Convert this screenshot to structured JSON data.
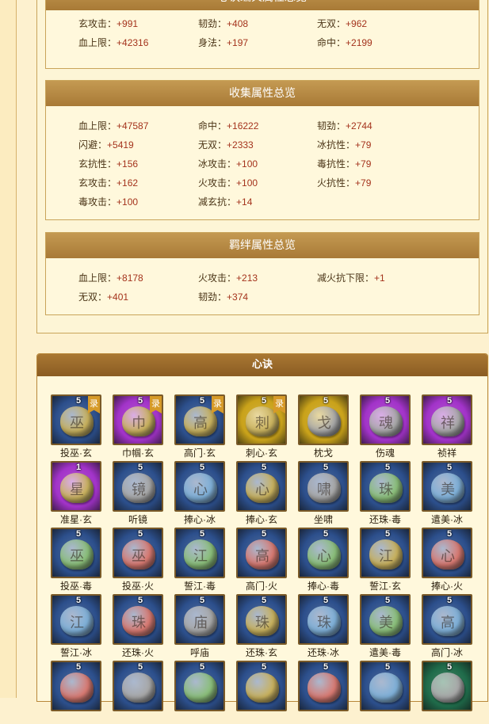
{
  "sections": [
    {
      "title": "心诀编火属性总览",
      "rows": [
        [
          {
            "label": "玄攻击：",
            "value": "+991"
          },
          {
            "label": "韧劲：",
            "value": "+408"
          },
          {
            "label": "无双：",
            "value": "+962"
          }
        ],
        [
          {
            "label": "血上限：",
            "value": "+42316"
          },
          {
            "label": "身法：",
            "value": "+197"
          },
          {
            "label": "命中：",
            "value": "+2199"
          }
        ]
      ]
    },
    {
      "title": "收集属性总览",
      "rows": [
        [
          {
            "label": "血上限：",
            "value": "+47587"
          },
          {
            "label": "命中：",
            "value": "+16222"
          },
          {
            "label": "韧劲：",
            "value": "+2744"
          }
        ],
        [
          {
            "label": "闪避：",
            "value": "+5419"
          },
          {
            "label": "无双：",
            "value": "+2333"
          },
          {
            "label": "冰抗性：",
            "value": "+79"
          }
        ],
        [
          {
            "label": "玄抗性：",
            "value": "+156"
          },
          {
            "label": "冰攻击：",
            "value": "+100"
          },
          {
            "label": "毒抗性：",
            "value": "+79"
          }
        ],
        [
          {
            "label": "玄攻击：",
            "value": "+162"
          },
          {
            "label": "火攻击：",
            "value": "+100"
          },
          {
            "label": "火抗性：",
            "value": "+79"
          }
        ],
        [
          {
            "label": "毒攻击：",
            "value": "+100"
          },
          {
            "label": "减玄抗：",
            "value": "+14"
          }
        ]
      ]
    },
    {
      "title": "羁绊属性总览",
      "rows": [
        [
          {
            "label": "血上限：",
            "value": "+8178"
          },
          {
            "label": "火攻击：",
            "value": "+213"
          },
          {
            "label": "减火抗下限：",
            "value": "+1"
          }
        ],
        [
          {
            "label": "无双：",
            "value": "+401"
          },
          {
            "label": "韧劲：",
            "value": "+374"
          }
        ]
      ]
    }
  ],
  "xinjue": {
    "title": "心诀",
    "items": [
      {
        "name": "投巫·玄",
        "level": "5",
        "badge": "录",
        "bg": "#2c4f8c",
        "stone": "#c9b25e",
        "glyph": "巫"
      },
      {
        "name": "巾帼·玄",
        "level": "5",
        "badge": "录",
        "bg": "#a233c9",
        "stone": "#c9b25e",
        "glyph": "巾"
      },
      {
        "name": "高门·玄",
        "level": "5",
        "badge": "录",
        "bg": "#2c4f8c",
        "stone": "#c9b25e",
        "glyph": "高"
      },
      {
        "name": "刺心·玄",
        "level": "5",
        "badge": "录",
        "bg": "#c9a21a",
        "stone": "#c9b25e",
        "glyph": "刺"
      },
      {
        "name": "枕戈",
        "level": "5",
        "badge": "",
        "bg": "#c9a21a",
        "stone": "#a8a8a8",
        "glyph": "戈"
      },
      {
        "name": "伤魂",
        "level": "5",
        "badge": "",
        "bg": "#a233c9",
        "stone": "#a8a8a8",
        "glyph": "魂"
      },
      {
        "name": "祯祥",
        "level": "5",
        "badge": "",
        "bg": "#a233c9",
        "stone": "#a8a8a8",
        "glyph": "祥"
      },
      {
        "name": "准星·玄",
        "level": "1",
        "badge": "",
        "bg": "#a233c9",
        "stone": "#c9b25e",
        "glyph": "星"
      },
      {
        "name": "听镜",
        "level": "5",
        "badge": "",
        "bg": "#2c4f8c",
        "stone": "#a8a8a8",
        "glyph": "镜"
      },
      {
        "name": "捧心·冰",
        "level": "5",
        "badge": "",
        "bg": "#2c4f8c",
        "stone": "#7fb0d8",
        "glyph": "心"
      },
      {
        "name": "捧心·玄",
        "level": "5",
        "badge": "",
        "bg": "#2c4f8c",
        "stone": "#c9b25e",
        "glyph": "心"
      },
      {
        "name": "坐啸",
        "level": "5",
        "badge": "",
        "bg": "#2c4f8c",
        "stone": "#a8a8a8",
        "glyph": "啸"
      },
      {
        "name": "还珠·毒",
        "level": "5",
        "badge": "",
        "bg": "#2c4f8c",
        "stone": "#8bbf7a",
        "glyph": "珠"
      },
      {
        "name": "遣美·冰",
        "level": "5",
        "badge": "",
        "bg": "#2c4f8c",
        "stone": "#7fb0d8",
        "glyph": "美"
      },
      {
        "name": "投巫·毒",
        "level": "5",
        "badge": "",
        "bg": "#2c4f8c",
        "stone": "#8bbf7a",
        "glyph": "巫"
      },
      {
        "name": "投巫·火",
        "level": "5",
        "badge": "",
        "bg": "#2c4f8c",
        "stone": "#d97a72",
        "glyph": "巫"
      },
      {
        "name": "誓江·毒",
        "level": "5",
        "badge": "",
        "bg": "#2c4f8c",
        "stone": "#8bbf7a",
        "glyph": "江"
      },
      {
        "name": "高门·火",
        "level": "5",
        "badge": "",
        "bg": "#2c4f8c",
        "stone": "#d97a72",
        "glyph": "高"
      },
      {
        "name": "捧心·毒",
        "level": "5",
        "badge": "",
        "bg": "#2c4f8c",
        "stone": "#8bbf7a",
        "glyph": "心"
      },
      {
        "name": "誓江·玄",
        "level": "5",
        "badge": "",
        "bg": "#2c4f8c",
        "stone": "#c9b25e",
        "glyph": "江"
      },
      {
        "name": "捧心·火",
        "level": "5",
        "badge": "",
        "bg": "#2c4f8c",
        "stone": "#d97a72",
        "glyph": "心"
      },
      {
        "name": "誓江·冰",
        "level": "5",
        "badge": "",
        "bg": "#2c4f8c",
        "stone": "#7fb0d8",
        "glyph": "江"
      },
      {
        "name": "还珠·火",
        "level": "5",
        "badge": "",
        "bg": "#2c4f8c",
        "stone": "#d97a72",
        "glyph": "珠"
      },
      {
        "name": "呼庙",
        "level": "5",
        "badge": "",
        "bg": "#2c4f8c",
        "stone": "#a8a8a8",
        "glyph": "庙"
      },
      {
        "name": "还珠·玄",
        "level": "5",
        "badge": "",
        "bg": "#2c4f8c",
        "stone": "#c9b25e",
        "glyph": "珠"
      },
      {
        "name": "还珠·冰",
        "level": "5",
        "badge": "",
        "bg": "#2c4f8c",
        "stone": "#7fb0d8",
        "glyph": "珠"
      },
      {
        "name": "遣美·毒",
        "level": "5",
        "badge": "",
        "bg": "#2c4f8c",
        "stone": "#8bbf7a",
        "glyph": "美"
      },
      {
        "name": "高门·冰",
        "level": "5",
        "badge": "",
        "bg": "#2c4f8c",
        "stone": "#7fb0d8",
        "glyph": "高"
      },
      {
        "name": "",
        "level": "5",
        "badge": "",
        "bg": "#2c4f8c",
        "stone": "#d97a72",
        "glyph": ""
      },
      {
        "name": "",
        "level": "5",
        "badge": "",
        "bg": "#2c4f8c",
        "stone": "#a8a8a8",
        "glyph": ""
      },
      {
        "name": "",
        "level": "5",
        "badge": "",
        "bg": "#2c4f8c",
        "stone": "#8bbf7a",
        "glyph": ""
      },
      {
        "name": "",
        "level": "5",
        "badge": "",
        "bg": "#2c4f8c",
        "stone": "#c9b25e",
        "glyph": ""
      },
      {
        "name": "",
        "level": "5",
        "badge": "",
        "bg": "#2c4f8c",
        "stone": "#d97a72",
        "glyph": ""
      },
      {
        "name": "",
        "level": "5",
        "badge": "",
        "bg": "#2c4f8c",
        "stone": "#7fb0d8",
        "glyph": ""
      },
      {
        "name": "",
        "level": "5",
        "badge": "",
        "bg": "#1f6b4a",
        "stone": "#a8a8a8",
        "glyph": ""
      }
    ]
  }
}
